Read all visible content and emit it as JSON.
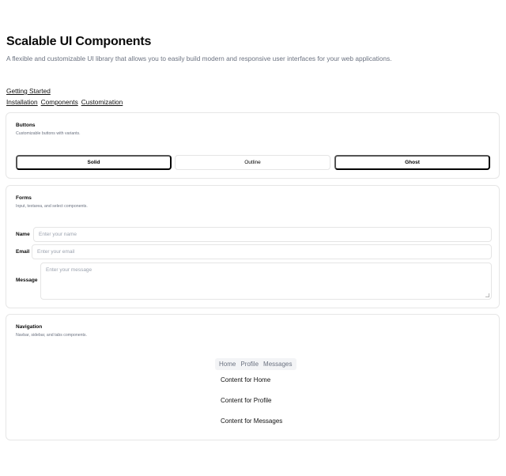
{
  "header": {
    "title": "Scalable UI Components",
    "description": "A flexible and customizable UI library that allows you to easily build modern and responsive user interfaces for your web applications."
  },
  "nav": {
    "primary": "Getting Started",
    "links": [
      "Installation",
      "Components",
      "Customization"
    ]
  },
  "buttons_card": {
    "title": "Buttons",
    "description": "Customizable buttons with variants.",
    "solid_label": "Solid",
    "outline_label": "Outline",
    "ghost_label": "Ghost"
  },
  "forms_card": {
    "title": "Forms",
    "description": "Input, textarea, and select components.",
    "name_label": "Name",
    "name_placeholder": "Enter your name",
    "email_label": "Email",
    "email_placeholder": "Enter your email",
    "message_label": "Message",
    "message_placeholder": "Enter your message"
  },
  "nav_card": {
    "title": "Navigation",
    "description": "Navbar, sidebar, and tabs components.",
    "tabs": [
      "Home",
      "Profile",
      "Messages"
    ],
    "contents": [
      "Content for Home",
      "Content for Profile",
      "Content for Messages"
    ]
  }
}
